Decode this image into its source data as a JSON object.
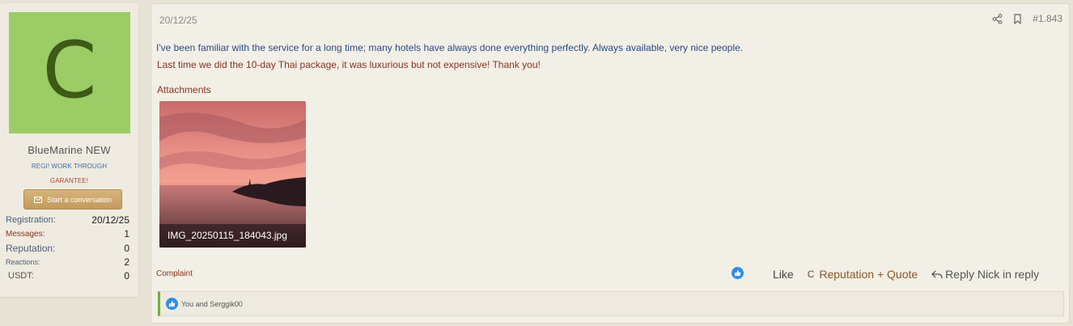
{
  "user": {
    "avatar_letter": "C",
    "avatar_color": "#9ccc65",
    "name": "BlueMarine NEW",
    "title_line1": "REGI! WORK THROUGH",
    "title_line2": "GARANTEE!",
    "start_conversation_label": "Start a conversation",
    "stats": [
      {
        "label": "Registration:",
        "value": "20/12/25"
      },
      {
        "label": "Messages:",
        "value": "1"
      },
      {
        "label": "Reputation:",
        "value": "0"
      },
      {
        "label": "Reactions:",
        "value": "2"
      },
      {
        "label": "USDT:",
        "value": "0"
      }
    ]
  },
  "post": {
    "date": "20/12/25",
    "number": "#1.843",
    "message_line1": "I've been familiar with the service for a long time; many hotels have always done everything perfectly. Always available, very nice people.",
    "message_line2": "Last time we did the 10-day Thai package, it was luxurious but not expensive! Thank you!",
    "attachments_label": "Attachments",
    "attachment_filename": "IMG_20250115_184043.jpg",
    "complaint_label": "Complaint",
    "actions": {
      "like": "Like",
      "reputation_quote": "Reputation + Quote",
      "reply": "Reply Nick in reply"
    },
    "likes_text": "You and Serggik00"
  },
  "colors": {
    "accent_blue": "#2d8ee6",
    "button_gold": "#c39a5c",
    "likes_border_green": "#6fae3c"
  }
}
